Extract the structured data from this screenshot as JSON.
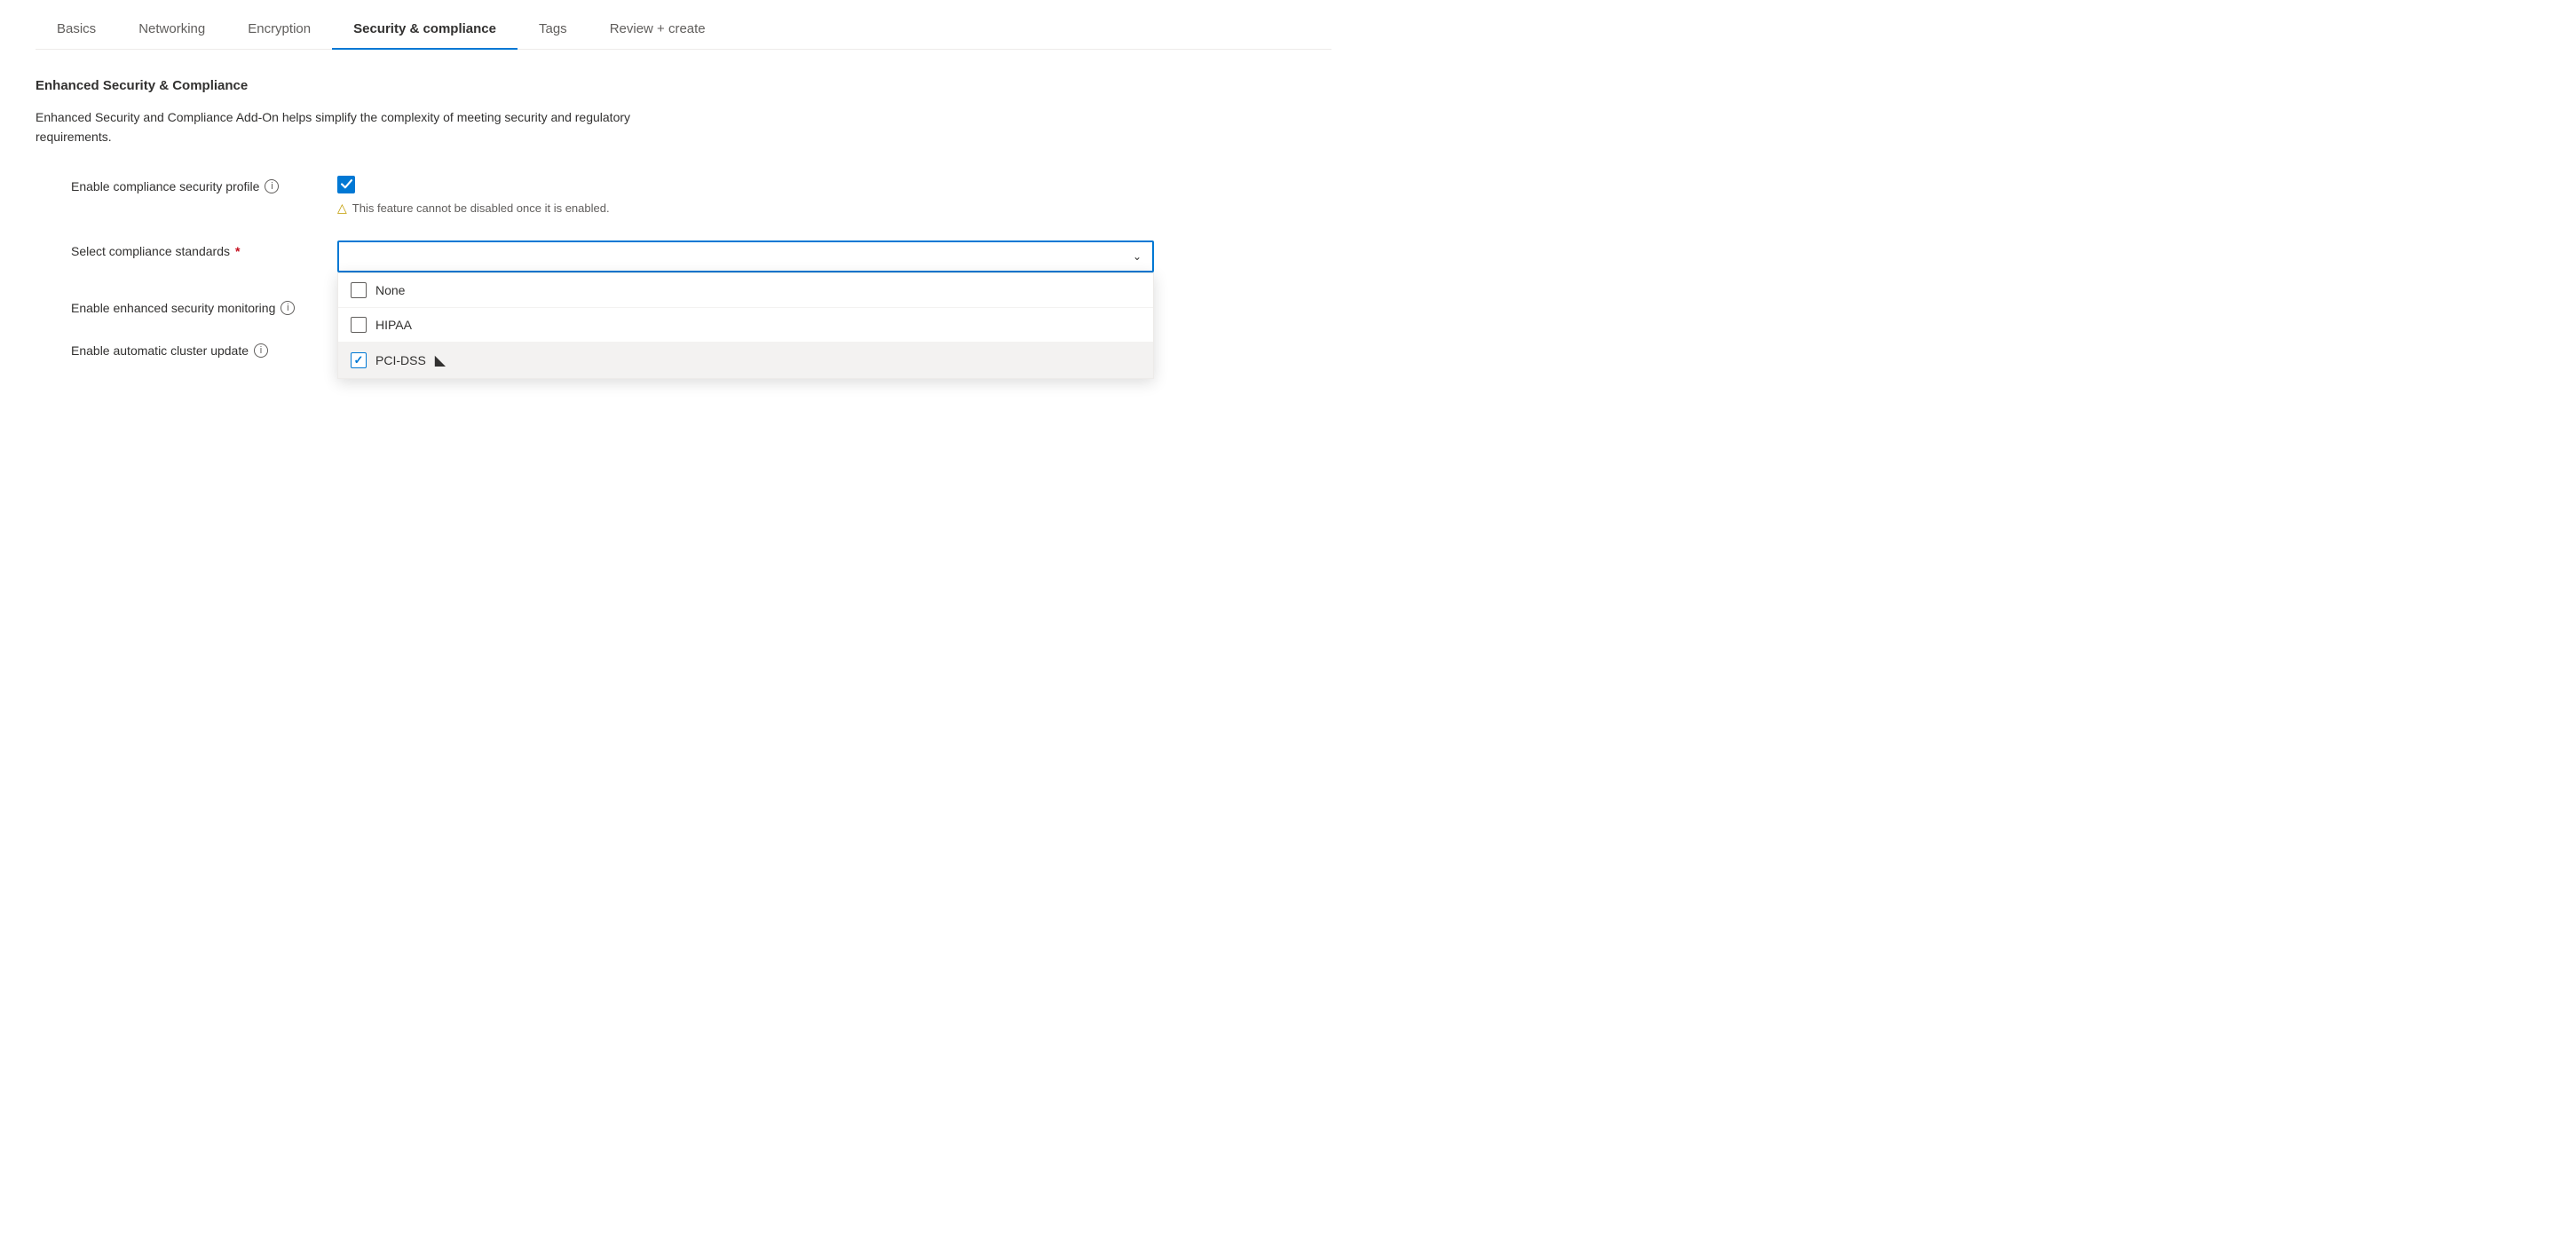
{
  "tabs": [
    {
      "id": "basics",
      "label": "Basics",
      "active": false
    },
    {
      "id": "networking",
      "label": "Networking",
      "active": false
    },
    {
      "id": "encryption",
      "label": "Encryption",
      "active": false
    },
    {
      "id": "security",
      "label": "Security & compliance",
      "active": true
    },
    {
      "id": "tags",
      "label": "Tags",
      "active": false
    },
    {
      "id": "review",
      "label": "Review + create",
      "active": false
    }
  ],
  "section": {
    "title": "Enhanced Security & Compliance",
    "description": "Enhanced Security and Compliance Add-On helps simplify the complexity of meeting security and regulatory requirements."
  },
  "fields": {
    "compliance_profile": {
      "label": "Enable compliance security profile",
      "checked": true,
      "warning": "This feature cannot be disabled once it is enabled."
    },
    "compliance_standards": {
      "label": "Select compliance standards",
      "required": true,
      "placeholder": "",
      "options": [
        {
          "id": "none",
          "label": "None",
          "checked": false
        },
        {
          "id": "hipaa",
          "label": "HIPAA",
          "checked": false
        },
        {
          "id": "pci_dss",
          "label": "PCI-DSS",
          "checked": true
        }
      ]
    },
    "security_monitoring": {
      "label": "Enable enhanced security monitoring",
      "checked": true,
      "disabled": true
    },
    "cluster_update": {
      "label": "Enable automatic cluster update",
      "checked": true,
      "disabled": true
    }
  },
  "icons": {
    "info": "ⓘ",
    "chevron_down": "∨",
    "warning_triangle": "△",
    "checkmark": "✓"
  }
}
